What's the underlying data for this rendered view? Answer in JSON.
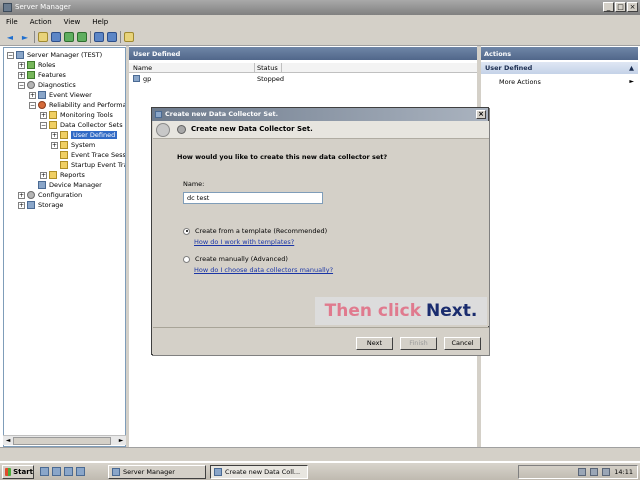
{
  "window": {
    "title": "Server Manager"
  },
  "menu": [
    "File",
    "Action",
    "View",
    "Help"
  ],
  "tree": [
    {
      "label": "Server Manager (TEST)",
      "level": 0,
      "exp": "-",
      "icon": "server-icon"
    },
    {
      "label": "Roles",
      "level": 1,
      "exp": "+",
      "icon": "roles-icon"
    },
    {
      "label": "Features",
      "level": 1,
      "exp": "+",
      "icon": "features-icon"
    },
    {
      "label": "Diagnostics",
      "level": 1,
      "exp": "-",
      "icon": "diagnostics-icon"
    },
    {
      "label": "Event Viewer",
      "level": 2,
      "exp": "+",
      "icon": "event-viewer-icon"
    },
    {
      "label": "Reliability and Performance",
      "level": 2,
      "exp": "-",
      "icon": "performance-icon"
    },
    {
      "label": "Monitoring Tools",
      "level": 3,
      "exp": "+",
      "icon": "folder-icon"
    },
    {
      "label": "Data Collector Sets",
      "level": 3,
      "exp": "-",
      "icon": "folder-icon"
    },
    {
      "label": "User Defined",
      "level": 4,
      "exp": "+",
      "icon": "folder-icon",
      "selected": true
    },
    {
      "label": "System",
      "level": 4,
      "exp": "+",
      "icon": "folder-icon"
    },
    {
      "label": "Event Trace Sessions",
      "level": 4,
      "exp": "",
      "icon": "folder-icon"
    },
    {
      "label": "Startup Event Trace Sessions",
      "level": 4,
      "exp": "",
      "icon": "folder-icon"
    },
    {
      "label": "Reports",
      "level": 3,
      "exp": "+",
      "icon": "folder-icon"
    },
    {
      "label": "Device Manager",
      "level": 2,
      "exp": "",
      "icon": "device-manager-icon"
    },
    {
      "label": "Configuration",
      "level": 1,
      "exp": "+",
      "icon": "configuration-icon"
    },
    {
      "label": "Storage",
      "level": 1,
      "exp": "+",
      "icon": "storage-icon"
    }
  ],
  "center": {
    "header": "User Defined",
    "columns": [
      "Name",
      "Status"
    ],
    "rows": [
      {
        "name": "gp",
        "status": "Stopped"
      }
    ]
  },
  "actions": {
    "header": "Actions",
    "section": "User Defined",
    "item": "More Actions"
  },
  "taskbar": {
    "start": "Start",
    "tasks": [
      "Server Manager",
      "Create new Data Coll..."
    ],
    "clock": "14:11"
  },
  "dialog": {
    "title": "Create new Data Collector Set.",
    "heading": "Create new Data Collector Set.",
    "question": "How would you like to create this new data collector set?",
    "name_label": "Name:",
    "name_value": "dc test",
    "option1": "Create from a template (Recommended)",
    "link1": "How do I work with templates?",
    "option2": "Create manually (Advanced)",
    "link2": "How do I choose data collectors manually?",
    "callout_a": "Then click",
    "callout_b": "Next.",
    "buttons": {
      "next": "Next",
      "finish": "Finish",
      "cancel": "Cancel"
    }
  }
}
